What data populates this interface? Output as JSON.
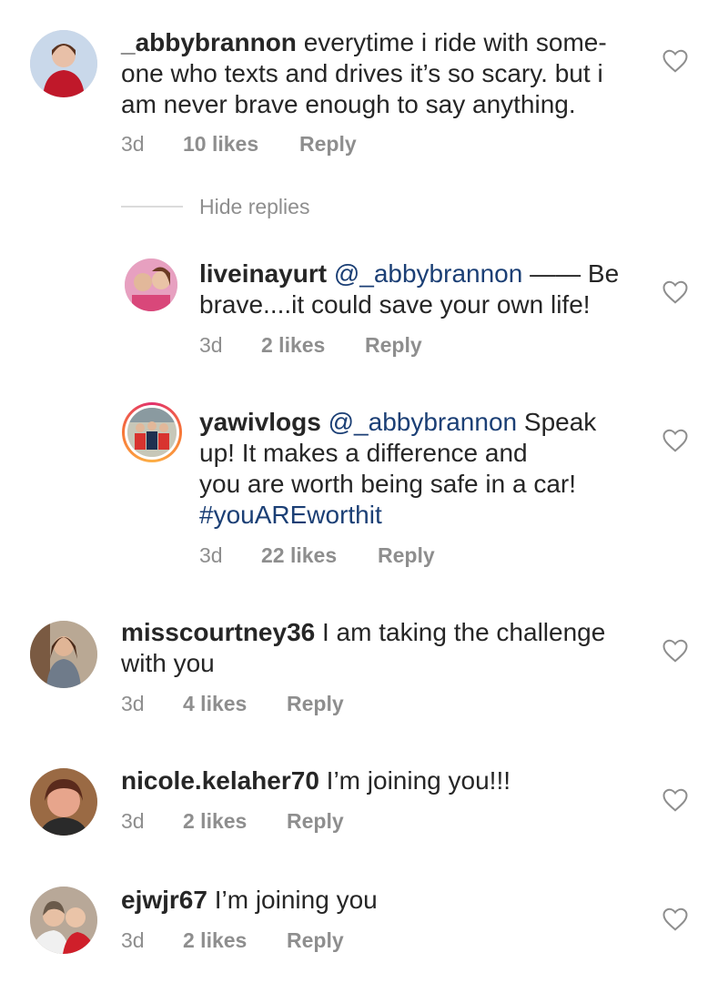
{
  "comments": [
    {
      "username": "_abbybrannon",
      "lines": [
        "everytime i ride with some-",
        "one who texts and drives it’s so scary. but i",
        "am never brave enough to say anything."
      ],
      "time": "3d",
      "likes": "10 likes",
      "reply": "Reply"
    },
    {
      "username": "liveinayurt",
      "mention": "@_abbybrannon",
      "line1_rest": " —— Be",
      "line2": "brave....it could save your own life!",
      "time": "3d",
      "likes": "2 likes",
      "reply": "Reply"
    },
    {
      "username": "yawivlogs",
      "mention": "@_abbybrannon",
      "line1_rest": " Speak",
      "line2": "up! It makes a difference and",
      "line3": "you are worth being safe in a car!",
      "hashtag": "#youAREworthit",
      "time": "3d",
      "likes": "22 likes",
      "reply": "Reply"
    },
    {
      "username": "misscourtney36",
      "line1_rest": " I am taking the challenge",
      "line2": "with you",
      "time": "3d",
      "likes": "4 likes",
      "reply": "Reply"
    },
    {
      "username": "nicole.kelaher70",
      "line1_rest": " I’m joining you!!!",
      "time": "3d",
      "likes": "2 likes",
      "reply": "Reply"
    },
    {
      "username": "ejwjr67",
      "line1_rest": " I’m joining you",
      "time": "3d",
      "likes": "2 likes",
      "reply": "Reply"
    }
  ],
  "hide_replies": "Hide replies",
  "colors": {
    "mention": "#1b3f75",
    "meta": "#8e8e8e",
    "text": "#262626"
  }
}
